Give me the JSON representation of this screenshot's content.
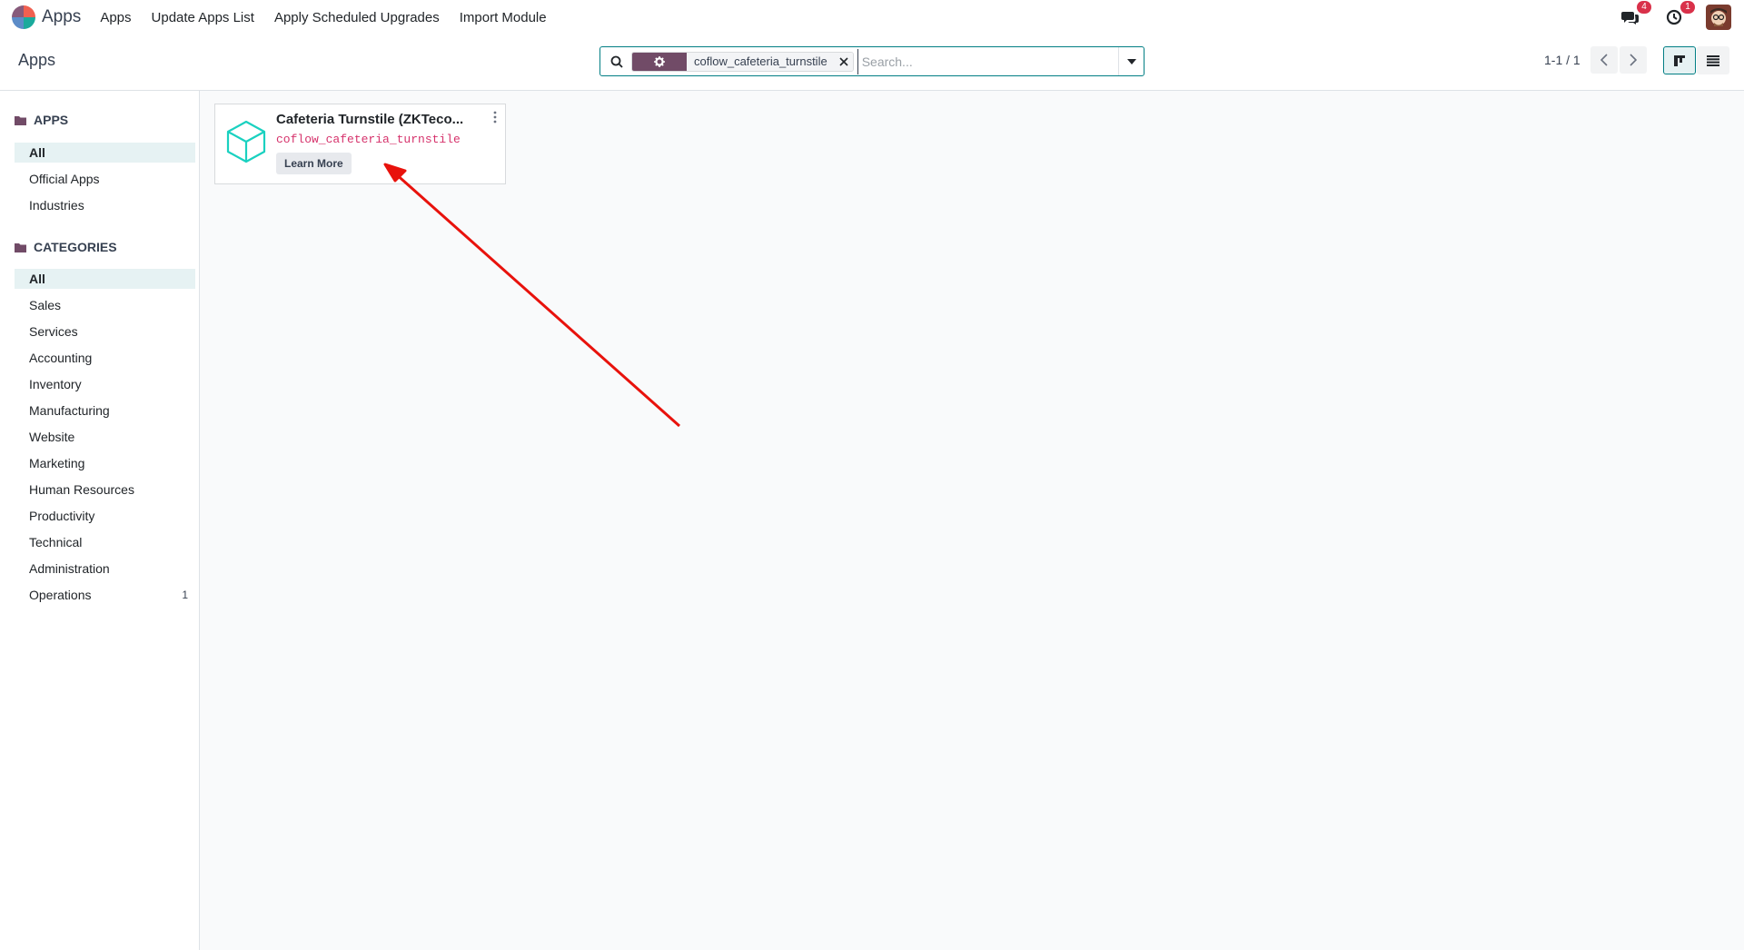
{
  "navbar": {
    "app_name": "Apps",
    "menu": [
      "Apps",
      "Update Apps List",
      "Apply Scheduled Upgrades",
      "Import Module"
    ],
    "messages_count": "4",
    "activities_count": "1"
  },
  "control_panel": {
    "title": "Apps",
    "search": {
      "facet_value": "coflow_cafeteria_turnstile",
      "placeholder": "Search..."
    },
    "pager": "1-1 / 1"
  },
  "sidebar": {
    "apps_header": "APPS",
    "apps_items": [
      "All",
      "Official Apps",
      "Industries"
    ],
    "categories_header": "CATEGORIES",
    "category_items": [
      "All",
      "Sales",
      "Services",
      "Accounting",
      "Inventory",
      "Manufacturing",
      "Website",
      "Marketing",
      "Human Resources",
      "Productivity",
      "Technical",
      "Administration",
      "Operations"
    ],
    "operations_count": "1"
  },
  "card": {
    "title": "Cafeteria Turnstile (ZKTeco...",
    "technical_name": "coflow_cafeteria_turnstile",
    "button": "Learn More"
  },
  "colors": {
    "accent": "#017e84",
    "brand": "#714b67",
    "annotation": "#e8120c"
  }
}
